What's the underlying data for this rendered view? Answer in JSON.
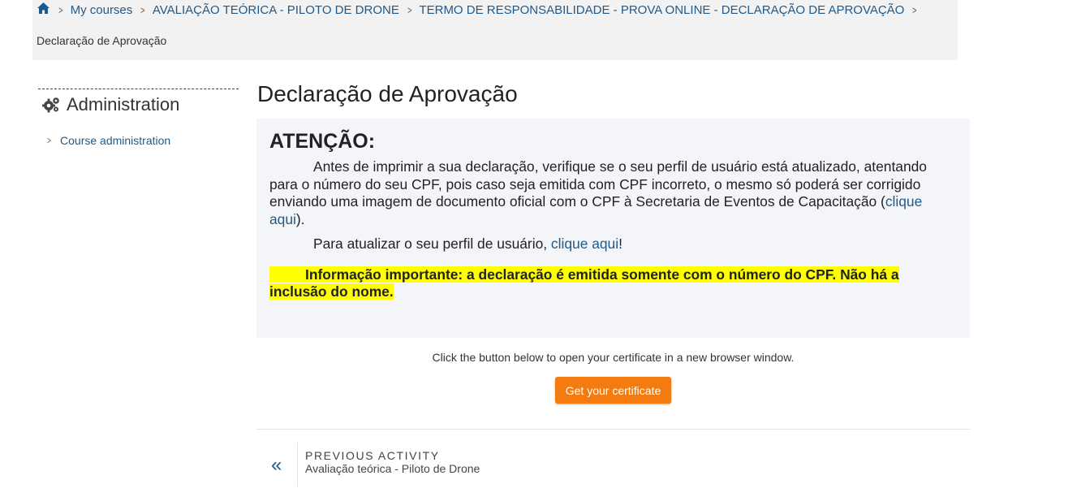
{
  "breadcrumb": {
    "items": [
      "My courses",
      "AVALIAÇÃO TEÓRICA - PILOTO DE DRONE",
      "TERMO DE RESPONSABILIDADE - PROVA ONLINE - DECLARAÇÃO DE APROVAÇÃO"
    ],
    "current": "Declaração de Aprovação"
  },
  "sidebar": {
    "title": "Administration",
    "link": "Course administration"
  },
  "main": {
    "title": "Declaração de Aprovação",
    "notice": {
      "heading": "ATENÇÃO:",
      "para1_text": "Antes de imprimir a sua declaração, verifique se o seu perfil de usuário está atualizado, atentando para o número do seu CPF, pois caso seja emitida com CPF incorreto, o mesmo só poderá ser corrigido enviando uma imagem de documento oficial com o CPF à Secretaria de Eventos de Capacitação (",
      "para1_link": "clique aqui",
      "para1_end": ").",
      "para2_text": "Para atualizar o seu perfil de usuário, ",
      "para2_link": "clique aqui",
      "para2_end": "!",
      "important": "Informação importante: a declaração é emitida somente com o número do CPF. Não há a inclusão do nome."
    },
    "cert_note": "Click the button below to open your certificate in a new browser window.",
    "cert_button": "Get your certificate",
    "prev_label": "PREVIOUS ACTIVITY",
    "prev_name": "Avaliação teórica - Piloto de Drone"
  },
  "colors": {
    "link": "#1f5a8b",
    "button": "#f47b10",
    "highlight": "#ffff00"
  },
  "icons": {
    "home": "home-icon",
    "admin": "gears-icon",
    "prev": "double-chevron-left-icon"
  }
}
